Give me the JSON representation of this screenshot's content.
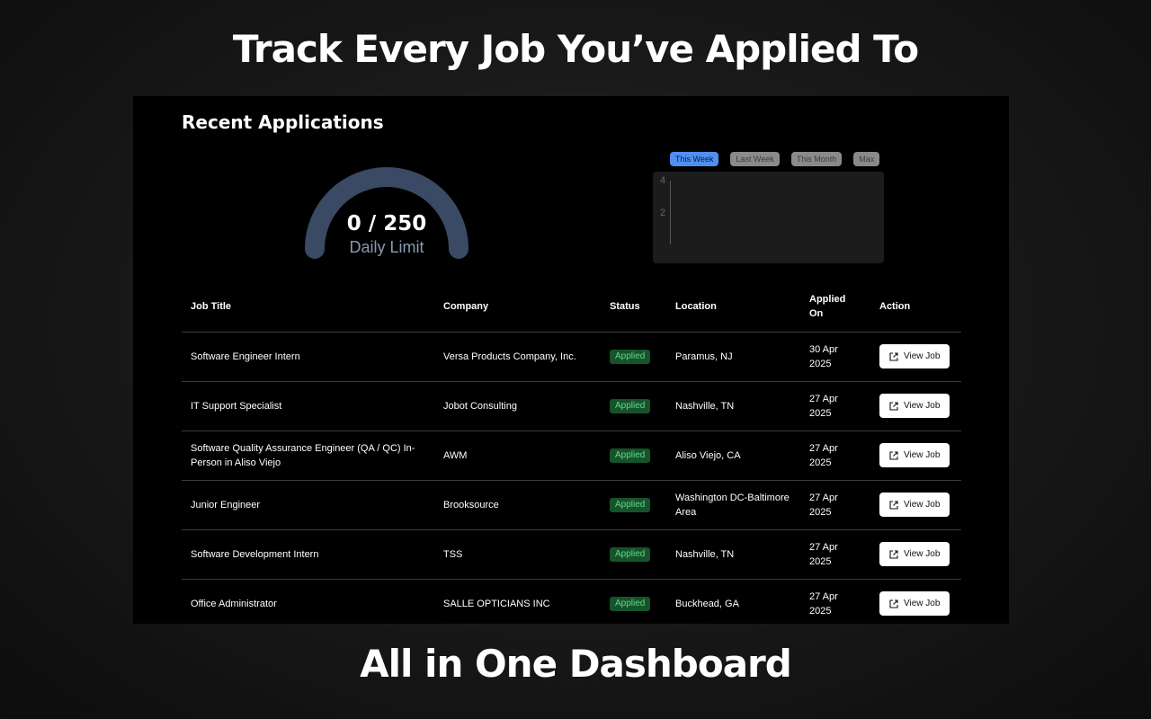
{
  "promo": {
    "headline_top": "Track Every Job You’ve Applied To",
    "headline_bottom": "All in One Dashboard"
  },
  "dashboard": {
    "title": "Recent Applications",
    "gauge": {
      "used": 0,
      "limit": 250,
      "value_text": "0 / 250",
      "label": "Daily Limit",
      "fill_fraction": 0
    },
    "range_tabs": [
      {
        "label": "This Week",
        "active": true
      },
      {
        "label": "Last Week",
        "active": false
      },
      {
        "label": "This Month",
        "active": false
      },
      {
        "label": "Max",
        "active": false
      }
    ],
    "mini_chart": {
      "y_ticks": [
        "4",
        "2"
      ]
    },
    "table": {
      "headers": {
        "job_title": "Job Title",
        "company": "Company",
        "status": "Status",
        "location": "Location",
        "applied_on": "Applied On",
        "action": "Action"
      },
      "rows": [
        {
          "title": "Software Engineer Intern",
          "company": "Versa Products Company, Inc.",
          "status": "Applied",
          "location": "Paramus, NJ",
          "date": "30 Apr 2025",
          "action": "View Job"
        },
        {
          "title": "IT Support Specialist",
          "company": "Jobot Consulting",
          "status": "Applied",
          "location": "Nashville, TN",
          "date": "27 Apr 2025",
          "action": "View Job"
        },
        {
          "title": "Software Quality Assurance Engineer (QA / QC) In-Person in Aliso Viejo",
          "company": "AWM",
          "status": "Applied",
          "location": "Aliso Viejo, CA",
          "date": "27 Apr 2025",
          "action": "View Job"
        },
        {
          "title": "Junior Engineer",
          "company": "Brooksource",
          "status": "Applied",
          "location": "Washington DC-Baltimore Area",
          "date": "27 Apr 2025",
          "action": "View Job"
        },
        {
          "title": "Software Development Intern",
          "company": "TSS",
          "status": "Applied",
          "location": "Nashville, TN",
          "date": "27 Apr 2025",
          "action": "View Job"
        },
        {
          "title": "Office Administrator",
          "company": "SALLE OPTICIANS INC",
          "status": "Applied",
          "location": "Buckhead, GA",
          "date": "27 Apr 2025",
          "action": "View Job"
        }
      ]
    }
  },
  "colors": {
    "gauge_track": "#3a4a64",
    "gauge_fill": "#6f8fc0",
    "tab_active": "#4f8ff0",
    "status_badge_bg": "#16532b",
    "status_badge_text": "#5fd88a"
  },
  "icons": {
    "view_job": "external-link-icon"
  }
}
